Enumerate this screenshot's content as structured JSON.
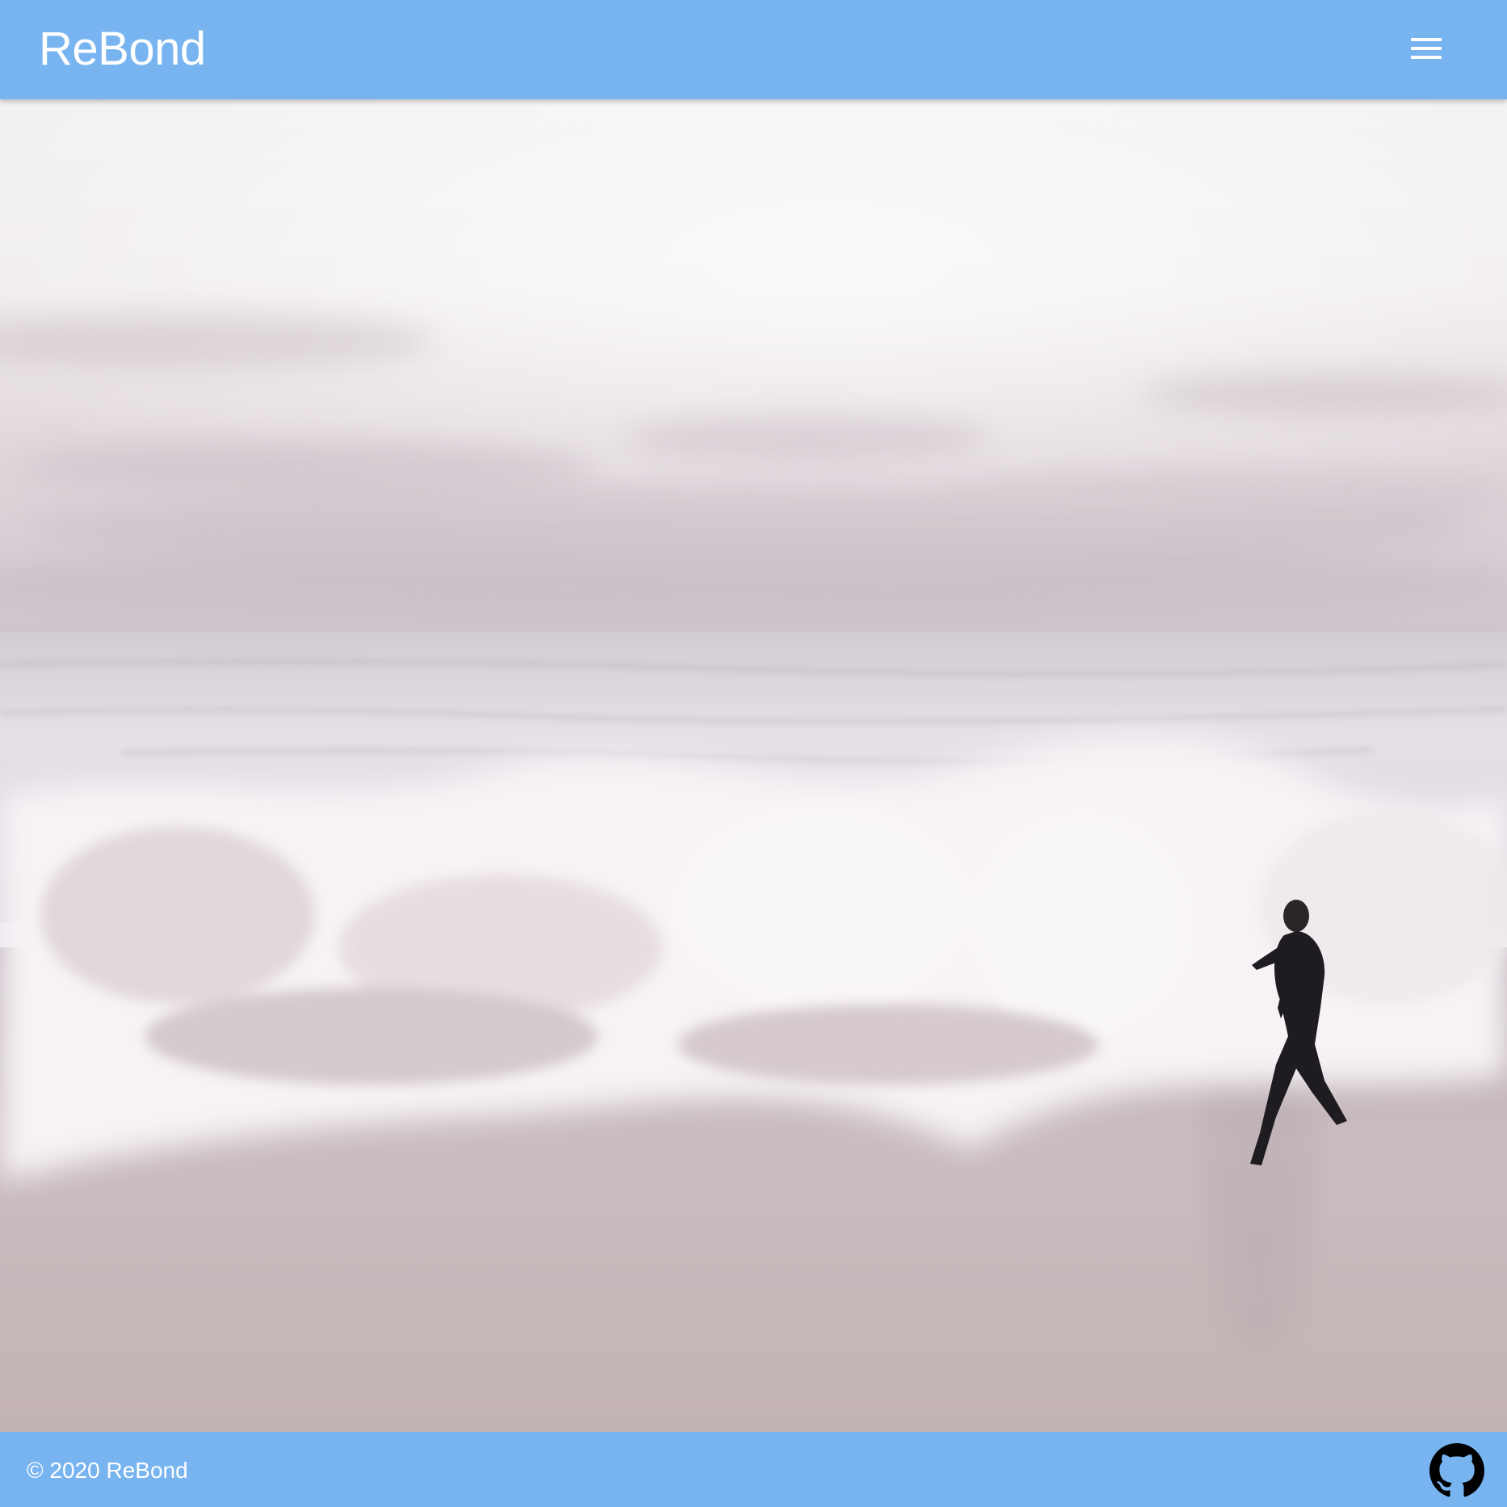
{
  "header": {
    "title": "ReBond",
    "menu_icon": "hamburger-menu-icon",
    "background_color": "#78b4f0"
  },
  "hero": {
    "image_subject": "person in wetsuit running along beach as a wave crashes at dusk"
  },
  "footer": {
    "copyright": "© 2020 ReBond",
    "github_icon": "github-icon",
    "background_color": "#78b4f0"
  }
}
